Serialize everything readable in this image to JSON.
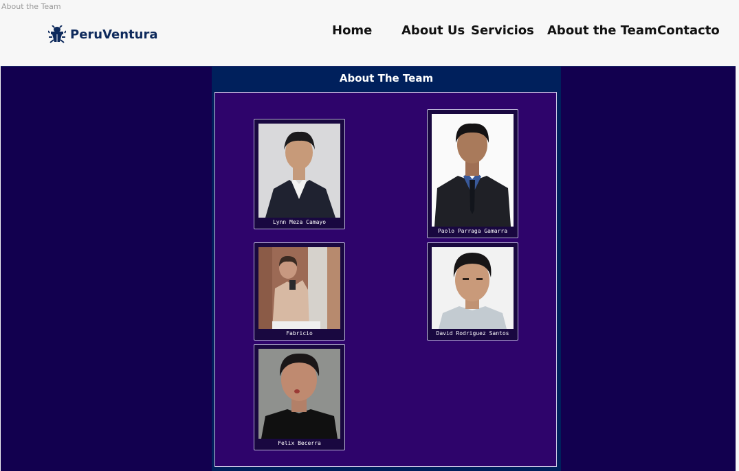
{
  "page": {
    "tab_title": "About the Team"
  },
  "header": {
    "logo": {
      "icon": "bug-logo-icon",
      "text": "PeruVentura",
      "color": "#0e2a5c"
    },
    "nav": [
      {
        "label": "Home"
      },
      {
        "label": "About Us"
      },
      {
        "label": "Servicios"
      },
      {
        "label": "About the Team"
      },
      {
        "label": "Contacto"
      }
    ]
  },
  "main": {
    "title": "About The Team",
    "colors": {
      "page_bg": "#12004f",
      "panel_bg": "#00205c",
      "gallery_bg": "#2e046b",
      "card_bg": "#190840"
    },
    "team": [
      {
        "name": "Lynn Meza Camayo"
      },
      {
        "name": "Paolo Parraga Gamarra"
      },
      {
        "name": "Fabricio"
      },
      {
        "name": "David Rodriguez Santos"
      },
      {
        "name": "Felix Becerra"
      }
    ]
  }
}
